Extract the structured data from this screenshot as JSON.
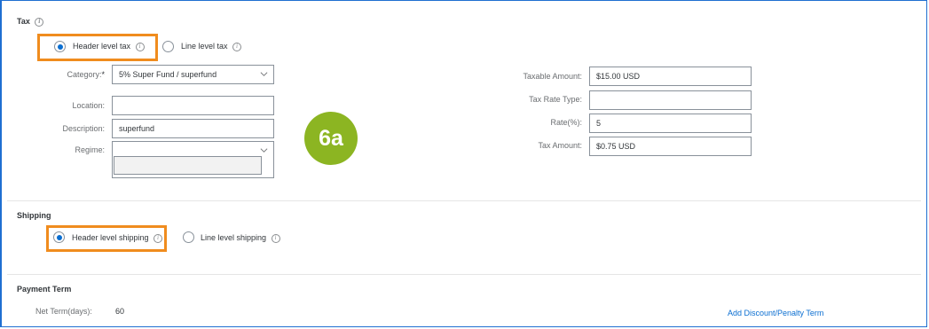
{
  "tax": {
    "title": "Tax",
    "options": {
      "header": "Header level tax",
      "line": "Line level tax"
    },
    "left_fields": {
      "category_label": "Category:",
      "category_value": "5% Super Fund / superfund",
      "location_label": "Location:",
      "location_value": "",
      "description_label": "Description:",
      "description_value": "superfund",
      "regime_label": "Regime:",
      "regime_value": ""
    },
    "right_fields": {
      "taxable_amount_label": "Taxable Amount:",
      "taxable_amount_value": "$15.00 USD",
      "tax_rate_type_label": "Tax Rate Type:",
      "tax_rate_type_value": "",
      "rate_label": "Rate(%):",
      "rate_value": "5",
      "tax_amount_label": "Tax Amount:",
      "tax_amount_value": "$0.75 USD"
    },
    "selected": "header"
  },
  "shipping": {
    "title": "Shipping",
    "options": {
      "header": "Header level shipping",
      "line": "Line level shipping"
    },
    "selected": "header"
  },
  "payment_term": {
    "title": "Payment Term",
    "net_term_label": "Net Term(days):",
    "net_term_value": "60",
    "add_discount_link": "Add Discount/Penalty Term"
  },
  "step_badge": "6a",
  "colors": {
    "highlight": "#f08c1e",
    "badge": "#8cb522",
    "accent": "#0a6ed1",
    "frame": "#1f6fd1"
  }
}
